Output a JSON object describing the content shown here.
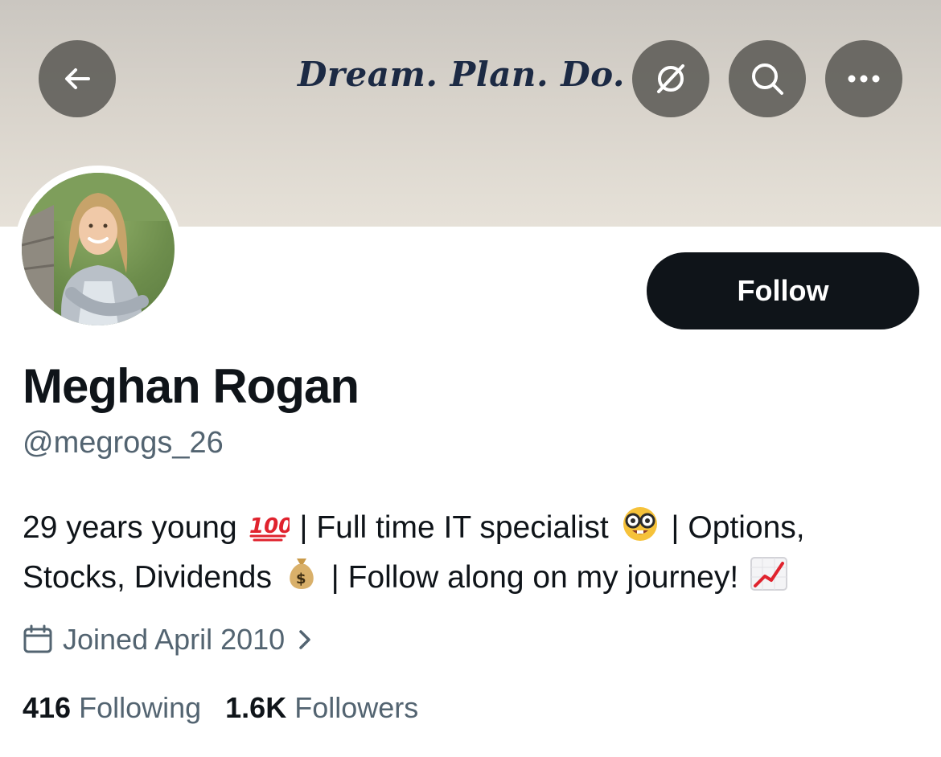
{
  "banner": {
    "text": "Dream. Plan. Do."
  },
  "header_icons": {
    "back": "arrow-left-icon",
    "grok": "grok-icon",
    "search": "search-icon",
    "more": "more-icon"
  },
  "profile": {
    "follow_label": "Follow",
    "display_name": "Meghan Rogan",
    "handle": "@megrogs_26",
    "bio": {
      "line1_a": "29 years young",
      "line1_b": "| Full time IT specialist",
      "line1_c": "| Options,",
      "line2_a": "Stocks, Dividends",
      "line2_b": "| Follow along on my journey!"
    },
    "joined": "Joined April 2010",
    "following_count": "416",
    "following_label": "Following",
    "followers_count": "1.6K",
    "followers_label": "Followers"
  },
  "colors": {
    "primary_text": "#0f1419",
    "secondary_text": "#536471",
    "follow_button": "#0f1419"
  }
}
